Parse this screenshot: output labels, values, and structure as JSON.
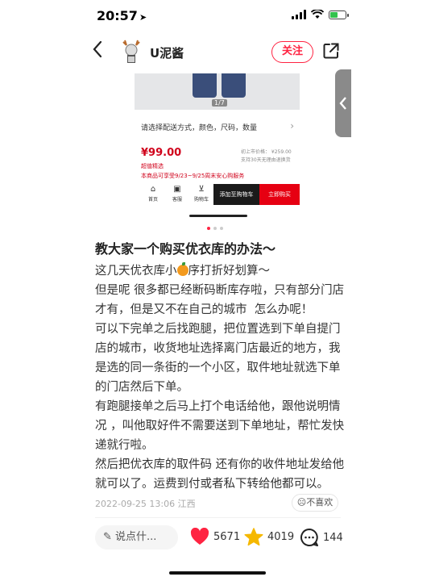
{
  "status_bar": {
    "time": "20:57",
    "battery_level": 0.55
  },
  "header": {
    "author_name": "U泥酱",
    "follow_label": "关注"
  },
  "product": {
    "page_counter": "1/7",
    "options_label": "请选择配送方式，颜色，尺码，数量",
    "price": "¥99.00",
    "price_tag": "超值精选",
    "promo": "本商品可享受9/23~9/25周末安心购服务",
    "orig_price": "初上市价格： ¥259.00",
    "return_note": "支持30天无理由退换货",
    "bar": {
      "home": "首页",
      "service": "客服",
      "cart": "购物车",
      "add_cart": "添加至购物车",
      "buy_now": "立即购买"
    }
  },
  "carousel": {
    "count": 3,
    "active": 0
  },
  "note": {
    "title": "教大家一个购买优衣库的办法～",
    "line1_pre": "这几天优衣库小",
    "line1_post": "序打折好划算～",
    "paragraphs": [
      "但是呢 很多都已经断码断库存啦，只有部分门店才有，但是又不在自己的城市  怎么办呢！",
      "可以下完单之后找跑腿，把位置选到下单自提门店的城市，收货地址选择离门店最近的地方，我是选的同一条街的一个小区，取件地址就选下单的门店然后下单。",
      "有跑腿接单之后马上打个电话给他，跟他说明情况 ，叫他取好件不需要送到下单地址，帮忙发快递就行啦。",
      "然后把优衣库的取件码 还有你的收件地址发给他就可以了。运费到付或者私下转给他都可以。"
    ],
    "date": "2022-09-25 13:06",
    "location": "江西",
    "dislike_label": "不喜欢"
  },
  "bottom_bar": {
    "comment_placeholder": "说点什...",
    "likes": "5671",
    "collects": "4019",
    "comments": "144"
  },
  "colors": {
    "accent": "#ff2442",
    "price_red": "#d0021b",
    "star": "#f5b800"
  }
}
